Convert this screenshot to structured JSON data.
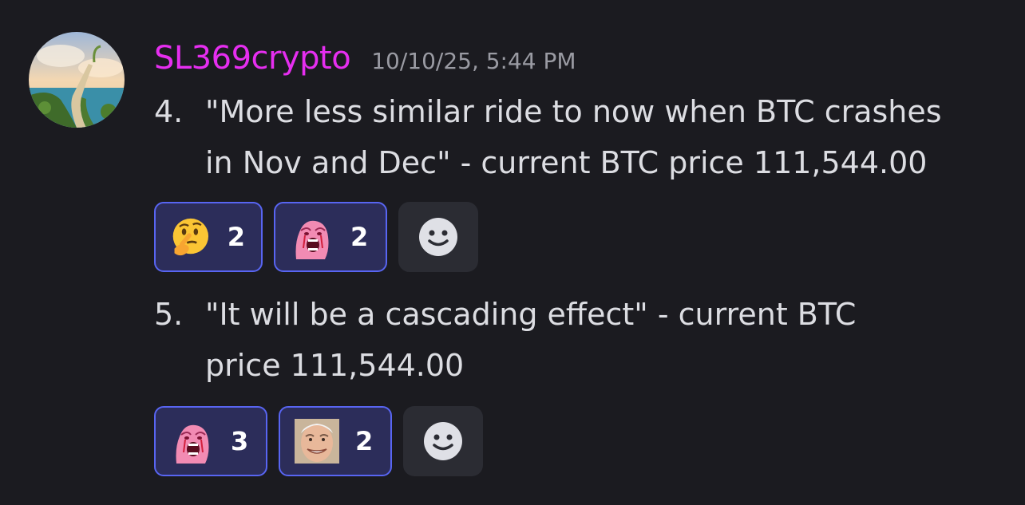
{
  "message": {
    "username": "SL369crypto",
    "timestamp": "10/10/25, 5:44 PM",
    "colors": {
      "username": "#e62ef0",
      "reaction_border": "#5865f2",
      "reaction_bg": "#2c2d5a",
      "background": "#1b1b20"
    },
    "items": [
      {
        "number": "4.",
        "lines": [
          "\"More less similar ride to now when BTC crashes",
          "in Nov and Dec\" - current BTC price 111,544.00"
        ],
        "reactions": [
          {
            "icon": "thinking-face-icon",
            "count": "2"
          },
          {
            "icon": "crying-wojak-icon",
            "count": "2"
          }
        ]
      },
      {
        "number": "5.",
        "lines": [
          "\"It will be a cascading effect\" -  current BTC",
          "price 111,544.00"
        ],
        "reactions": [
          {
            "icon": "crying-wojak-icon",
            "count": "3"
          },
          {
            "icon": "hide-the-pain-harold-icon",
            "count": "2"
          }
        ]
      }
    ]
  }
}
